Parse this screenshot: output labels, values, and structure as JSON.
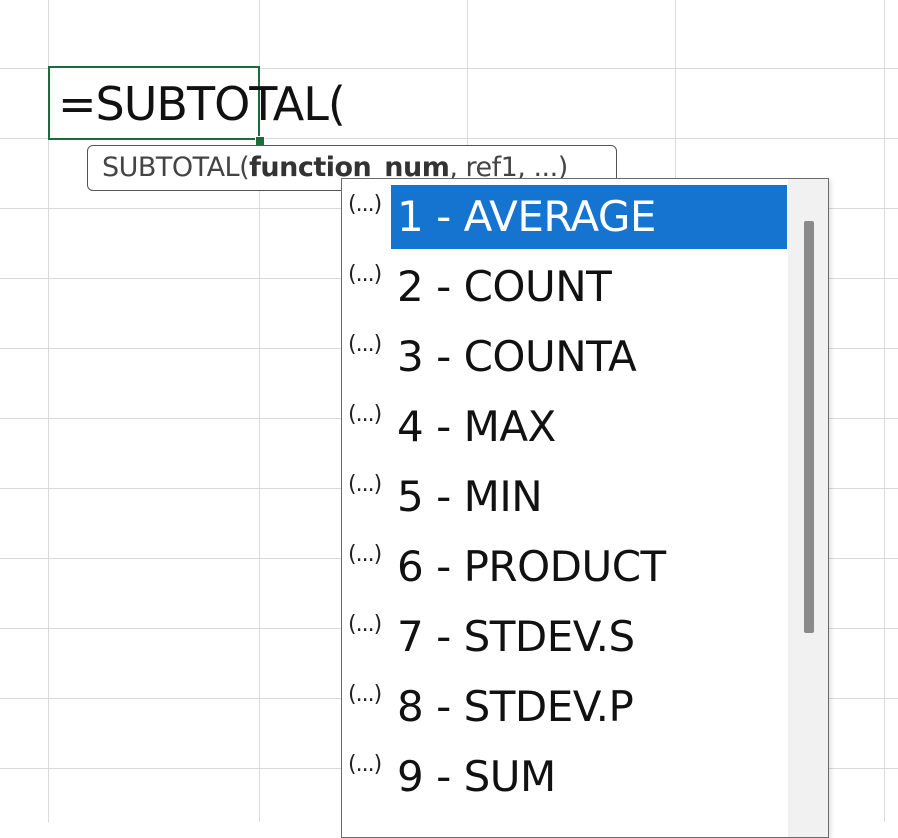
{
  "cell": {
    "formula": "=SUBTOTAL("
  },
  "tooltip": {
    "function_name": "SUBTOTAL(",
    "active_arg": "function_num",
    "rest_args": ", ref1, ...)"
  },
  "dropdown": {
    "item_icon": "(...)",
    "selected_index": 0,
    "items": [
      {
        "label": "1 - AVERAGE"
      },
      {
        "label": "2 - COUNT"
      },
      {
        "label": "3 - COUNTA"
      },
      {
        "label": "4 - MAX"
      },
      {
        "label": "5 - MIN"
      },
      {
        "label": "6 - PRODUCT"
      },
      {
        "label": "7 - STDEV.S"
      },
      {
        "label": "8 - STDEV.P"
      },
      {
        "label": "9 - SUM"
      }
    ]
  },
  "colors": {
    "selection": "#1674d1",
    "active_cell_border": "#1e6b3a",
    "gridline": "#d9d9d9"
  }
}
